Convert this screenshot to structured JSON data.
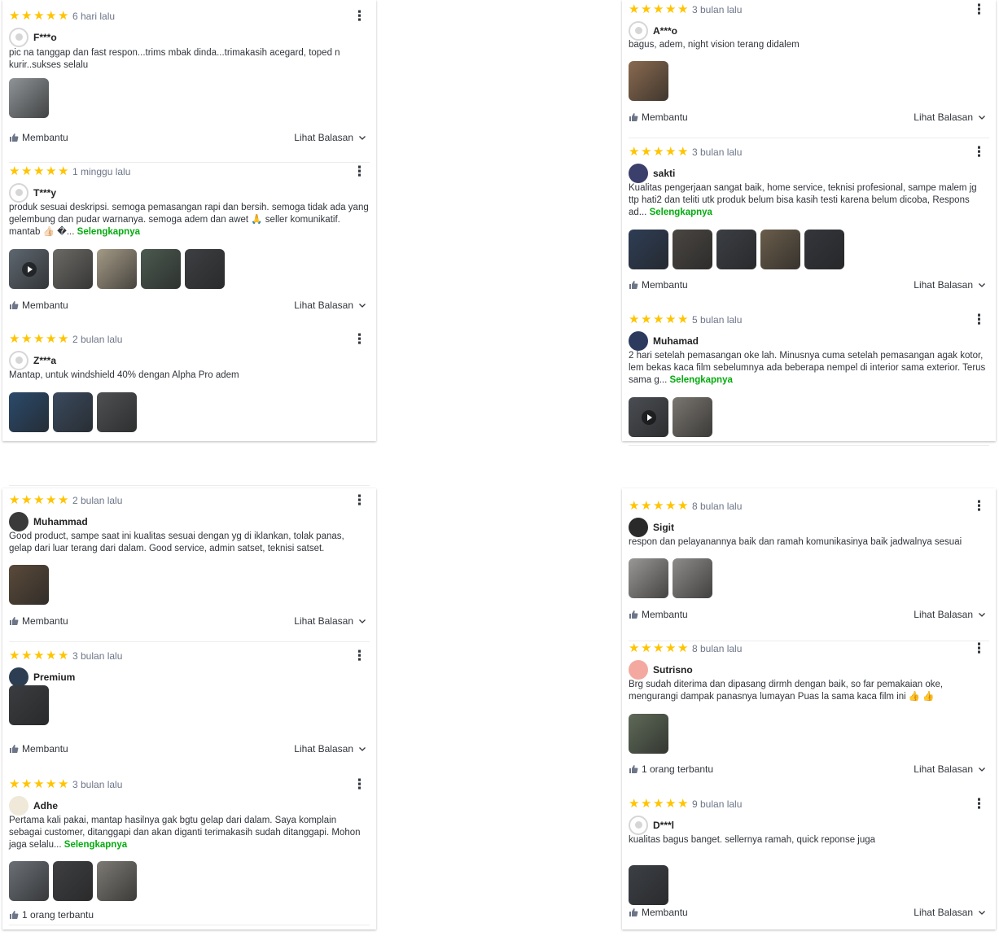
{
  "labels": {
    "helpful": "Membantu",
    "see_reply": "Lihat Balasan",
    "read_more": "Selengkapnya"
  },
  "colors": {
    "star": "#ffc400",
    "link": "#03ac0e"
  },
  "panels": [
    {
      "reviews": [
        {
          "date": "6 hari lalu",
          "user": "F***o",
          "avatar": "default",
          "text": "pic na tanggap dan fast respon...trims mbak dinda...trimakasih acegard, toped n kurir..sukses selalu",
          "images": [
            {
              "c": "#8f9497",
              "video": false
            }
          ],
          "helpful_label": "Membantu",
          "has_reply": true
        },
        {
          "date": "1 minggu lalu",
          "user": "T***y",
          "avatar": "default",
          "text": "produk sesuai deskripsi. semoga pemasangan rapi dan bersih. semoga tidak ada yang gelembung dan pudar warnanya. semoga adem dan awet 🙏 seller komunikatif. mantab 👍🏻 �...",
          "read_more": true,
          "images": [
            {
              "c": "#5e6770",
              "video": true
            },
            {
              "c": "#6b6a66",
              "video": false
            },
            {
              "c": "#a49a86",
              "video": false
            },
            {
              "c": "#4b5a50",
              "video": false
            },
            {
              "c": "#3d3f42",
              "video": false
            }
          ],
          "helpful_label": "Membantu",
          "has_reply": true
        },
        {
          "date": "2 bulan lalu",
          "user": "Z***a",
          "avatar": "default",
          "text": "Mantap, untuk windshield 40% dengan Alpha Pro adem",
          "images": [
            {
              "c": "#2b4a6b",
              "video": false
            },
            {
              "c": "#3a4a5e",
              "video": false
            },
            {
              "c": "#4e5052",
              "video": false
            }
          ],
          "helpful_label": "",
          "has_reply": false
        }
      ]
    },
    {
      "reviews": [
        {
          "date": "3 bulan lalu",
          "user": "A***o",
          "avatar": "default",
          "text": "bagus, adem, night vision terang didalem",
          "images": [
            {
              "c": "#8a6a4f",
              "video": false
            }
          ],
          "helpful_label": "Membantu",
          "has_reply": true
        },
        {
          "date": "3 bulan lalu",
          "user": "sakti",
          "avatar": "#3a3f6b",
          "text": "Kualitas pengerjaan sangat baik, home service, teknisi profesional, sampe malem jg ttp hati2 dan teliti utk produk belum bisa kasih testi karena belum dicoba, Respons ad...",
          "read_more": true,
          "images": [
            {
              "c": "#2e3d55",
              "video": false
            },
            {
              "c": "#4a4642",
              "video": false
            },
            {
              "c": "#3b3e44",
              "video": false
            },
            {
              "c": "#6a5d4b",
              "video": false
            },
            {
              "c": "#34363c",
              "video": false
            }
          ],
          "helpful_label": "Membantu",
          "has_reply": true
        },
        {
          "date": "5 bulan lalu",
          "user": "Muhamad",
          "avatar": "#2c3a5e",
          "text": "2 hari setelah pemasangan oke lah. Minusnya cuma setelah pemasangan agak kotor, lem bekas kaca film sebelumnya ada beberapa nempel di interior sama exterior. Terus sama g...",
          "read_more": true,
          "images": [
            {
              "c": "#4a4d52",
              "video": true
            },
            {
              "c": "#7a7670",
              "video": false
            }
          ],
          "helpful_label": "",
          "has_reply": false
        }
      ]
    },
    {
      "reviews": [
        {
          "date": "2 bulan lalu",
          "user": "Muhammad",
          "avatar": "#3a3a3a",
          "text": "Good product, sampe saat ini kualitas sesuai dengan yg di iklankan, tolak panas, gelap dari luar terang dari dalam. Good service, admin satset, teknisi satset.",
          "images": [
            {
              "c": "#5a4a3a",
              "video": false
            }
          ],
          "helpful_label": "Membantu",
          "has_reply": true
        },
        {
          "date": "3 bulan lalu",
          "user": "Premium",
          "avatar": "#2e3e52",
          "text": "",
          "images": [
            {
              "c": "#3a3d40",
              "video": false
            }
          ],
          "helpful_label": "Membantu",
          "has_reply": true
        },
        {
          "date": "3 bulan lalu",
          "user": "Adhe",
          "avatar": "#f0e8d8",
          "text": "Pertama kali pakai, mantap hasilnya gak bgtu gelap dari dalam. Saya komplain sebagai customer, ditanggapi dan akan diganti terimakasih sudah ditanggapi. Mohon jaga selalu...",
          "read_more": true,
          "images": [
            {
              "c": "#6b7076",
              "video": false
            },
            {
              "c": "#3e3f42",
              "video": false
            },
            {
              "c": "#7d7a74",
              "video": false
            }
          ],
          "helpful_label": "1 orang terbantu",
          "has_reply": false
        }
      ]
    },
    {
      "reviews": [
        {
          "date": "8 bulan lalu",
          "user": "Sigit",
          "avatar": "#2a2a2a",
          "text": "respon dan pelayanannya baik dan ramah komunikasinya baik jadwalnya sesuai",
          "images": [
            {
              "c": "#9a9896",
              "video": false
            },
            {
              "c": "#8e8c8a",
              "video": false
            }
          ],
          "helpful_label": "Membantu",
          "has_reply": true
        },
        {
          "date": "8 bulan lalu",
          "user": "Sutrisno",
          "avatar": "#f3a9a0",
          "text": "Brg sudah diterima dan dipasang dirmh dengan baik, so far pemakaian oke, mengurangi dampak panasnya lumayan Puas la sama kaca film ini 👍 👍",
          "images": [
            {
              "c": "#5f6a58",
              "video": false
            }
          ],
          "helpful_label": "1 orang terbantu",
          "has_reply": true
        },
        {
          "date": "9 bulan lalu",
          "user": "D***l",
          "avatar": "default",
          "text": "kualitas bagus banget. sellernya ramah, quick reponse juga",
          "images": [
            {
              "c": "#3c4046",
              "video": false
            }
          ],
          "helpful_label": "Membantu",
          "has_reply": true
        }
      ]
    }
  ]
}
